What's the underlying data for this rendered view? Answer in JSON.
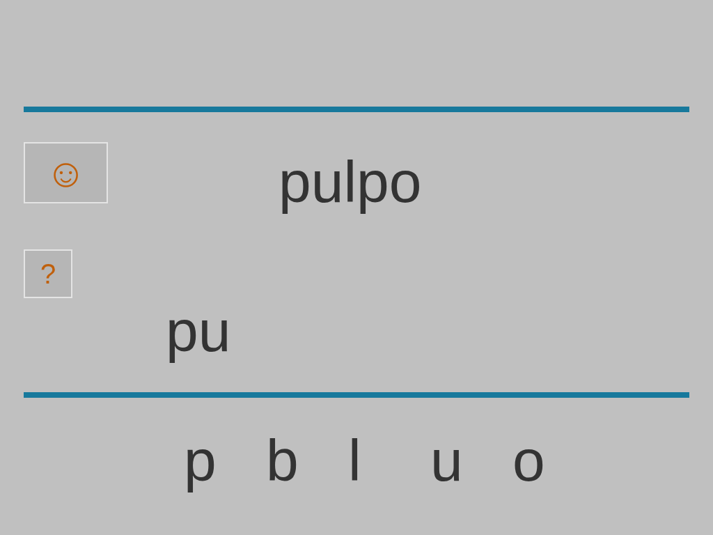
{
  "hint_button": {
    "label": "☺"
  },
  "help_button": {
    "label": "?"
  },
  "word": "pulpo",
  "answer": "pu",
  "letters": [
    "p",
    "b",
    "l",
    "u",
    "o"
  ]
}
